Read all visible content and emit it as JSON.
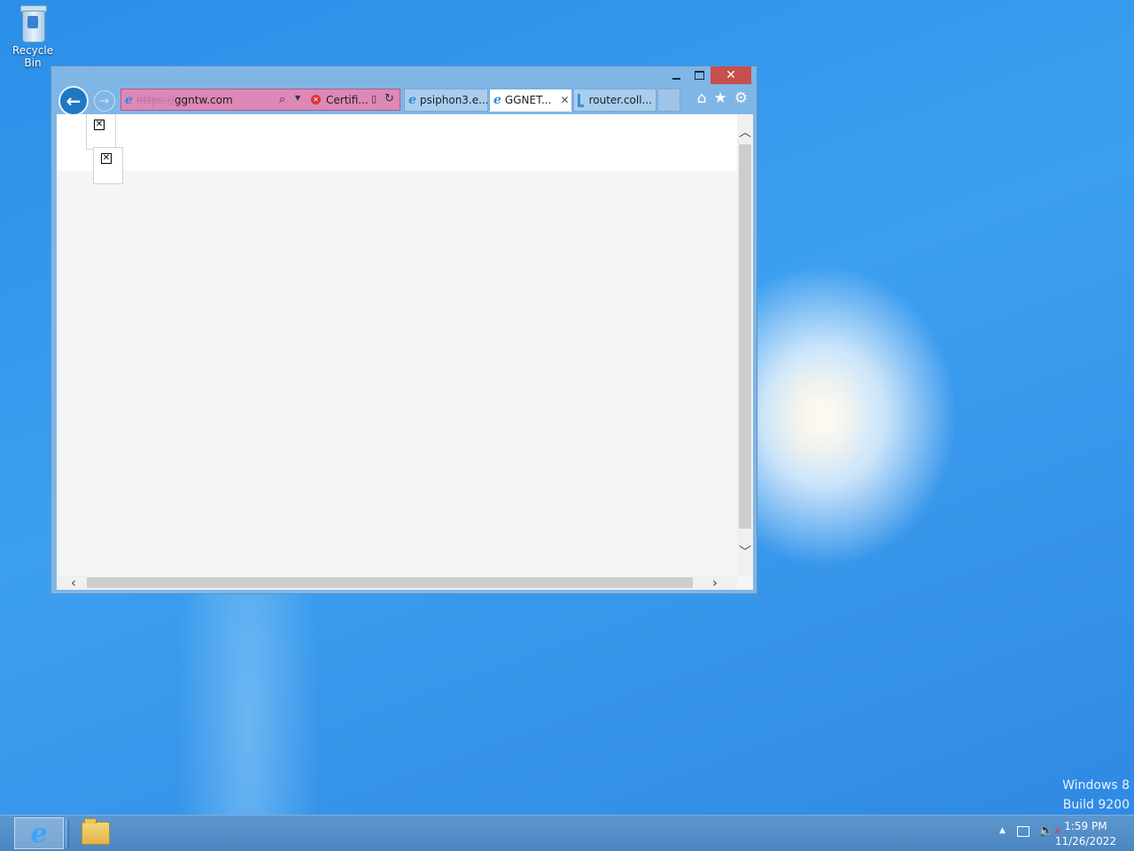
{
  "desktop": {
    "recycle_bin_label": "Recycle Bin",
    "watermark_line1": "Windows 8",
    "watermark_line2": "Build 9200"
  },
  "browser": {
    "window_controls": {
      "minimize": "minimize-icon",
      "maximize": "maximize-icon",
      "close": "✕"
    },
    "address_bar": {
      "url_protocol": "https://",
      "url_host": "ggntw.com",
      "certificate_label": "Certifi...",
      "background_color": "#dd88b6"
    },
    "tabs": [
      {
        "label": "psiphon3.e...",
        "active": false,
        "icon": "ie-icon"
      },
      {
        "label": "GGNET...",
        "active": true,
        "icon": "ie-icon"
      },
      {
        "label": "router.coll...",
        "active": false,
        "icon": "route-icon"
      }
    ],
    "right_icons": [
      "home-icon",
      "favorites-icon",
      "settings-icon"
    ]
  },
  "taskbar": {
    "pinned": [
      "internet-explorer-icon",
      "file-explorer-icon"
    ],
    "clock_time": "1:59 PM",
    "clock_date": "11/26/2022"
  }
}
